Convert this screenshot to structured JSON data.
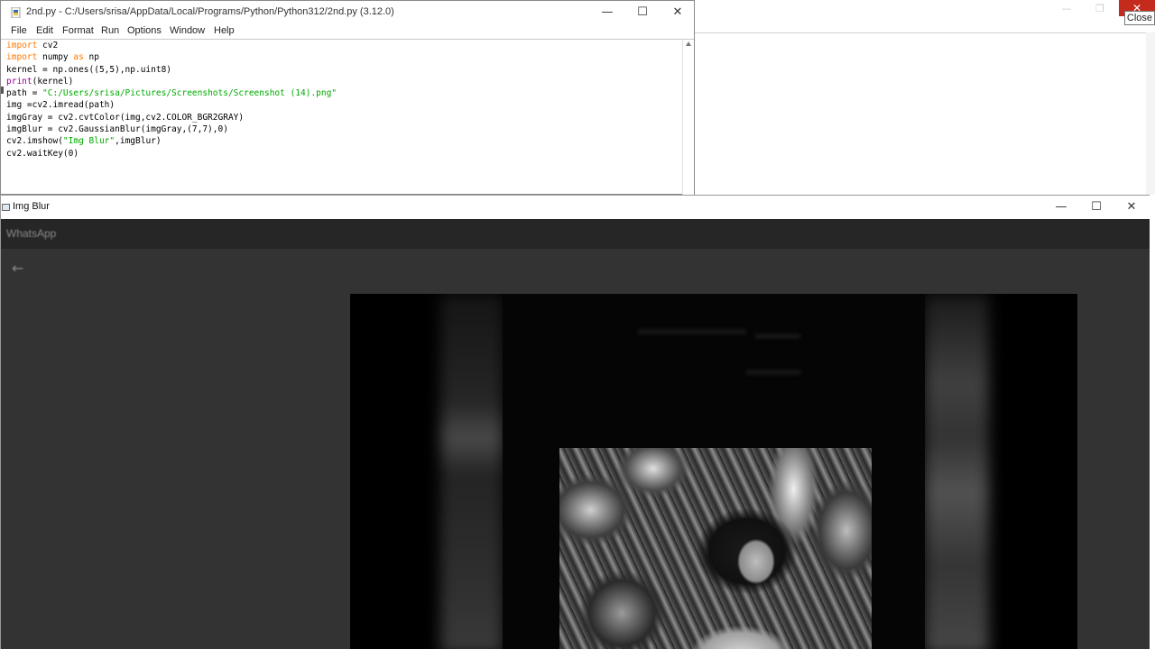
{
  "background_window": {
    "controls": [
      "—",
      "❐",
      "✕"
    ],
    "tooltip": "Close"
  },
  "idle": {
    "title": "2nd.py - C:/Users/srisa/AppData/Local/Programs/Python/Python312/2nd.py (3.12.0)",
    "menu": [
      "File",
      "Edit",
      "Format",
      "Run",
      "Options",
      "Window",
      "Help"
    ],
    "code_lines": [
      [
        {
          "t": "import",
          "c": "kw"
        },
        {
          "t": " cv2",
          "c": ""
        }
      ],
      [
        {
          "t": "import",
          "c": "kw"
        },
        {
          "t": " numpy ",
          "c": ""
        },
        {
          "t": "as",
          "c": "kw"
        },
        {
          "t": " np",
          "c": ""
        }
      ],
      [
        {
          "t": "kernel = np.ones((5,5),np.uint8)",
          "c": ""
        }
      ],
      [
        {
          "t": "print",
          "c": "builtin"
        },
        {
          "t": "(kernel)",
          "c": ""
        }
      ],
      [
        {
          "t": "path = ",
          "c": ""
        },
        {
          "t": "\"C:/Users/srisa/Pictures/Screenshots/Screenshot (14).png\"",
          "c": "str"
        }
      ],
      [
        {
          "t": "img =cv2.imread(path)",
          "c": ""
        }
      ],
      [
        {
          "t": "imgGray = cv2.cvtColor(img,cv2.COLOR_BGR2GRAY)",
          "c": ""
        }
      ],
      [
        {
          "t": "imgBlur = cv2.GaussianBlur(imgGray,(7,7),0)",
          "c": ""
        }
      ],
      [
        {
          "t": "cv2.imshow(",
          "c": ""
        },
        {
          "t": "\"Img Blur\"",
          "c": "str"
        },
        {
          "t": ",imgBlur)",
          "c": ""
        }
      ],
      [
        {
          "t": "cv2.waitKey(0)",
          "c": ""
        }
      ]
    ]
  },
  "window_controls": {
    "minimize": "—",
    "maximize": "☐",
    "close": "✕"
  },
  "cv_window": {
    "title": "Img Blur",
    "app_label": "WhatsApp",
    "back_arrow": "←"
  }
}
